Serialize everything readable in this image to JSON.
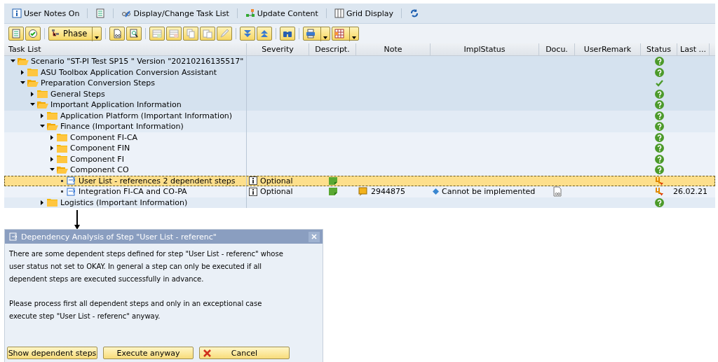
{
  "toolbar": [
    {
      "kind": "info",
      "label": "User Notes On"
    },
    {
      "kind": "list"
    },
    {
      "kind": "glasses",
      "label": "Display/Change Task List"
    },
    {
      "kind": "nodes",
      "label": "Update Content"
    },
    {
      "kind": "grid",
      "label": "Grid Display"
    },
    {
      "kind": "refresh"
    }
  ],
  "toolbar2": [
    {
      "kind": "icon"
    },
    {
      "kind": "icon"
    },
    {
      "kind": "sep"
    },
    {
      "kind": "menu",
      "label": "Phase"
    },
    {
      "kind": "sep"
    },
    {
      "kind": "icon"
    },
    {
      "kind": "icon"
    },
    {
      "kind": "sep"
    },
    {
      "kind": "icon"
    },
    {
      "kind": "icon"
    },
    {
      "kind": "icon"
    },
    {
      "kind": "icon"
    },
    {
      "kind": "icon"
    },
    {
      "kind": "sep"
    },
    {
      "kind": "icon"
    },
    {
      "kind": "icon"
    },
    {
      "kind": "sep"
    },
    {
      "kind": "icon"
    },
    {
      "kind": "sep"
    },
    {
      "kind": "menu"
    },
    {
      "kind": "menu"
    }
  ],
  "table": {
    "columns": [
      "Task List",
      "Severity",
      "Descript.",
      "Note",
      "ImplStatus",
      "Docu.",
      "UserRemark",
      "Status",
      "Last ..."
    ],
    "rows": [
      {
        "kind": "folder",
        "label": "Scenario \"ST-PI Test SP15 \" Version \"20210216135517\"",
        "expanded": true,
        "selected": false,
        "completed": false,
        "blocked": false,
        "children": [
          {
            "kind": "folder",
            "label": "ASU Toolbox Application Conversion Assistant",
            "expanded": false,
            "selected": false,
            "completed": false,
            "blocked": false
          },
          {
            "kind": "folder",
            "label": "Preparation Conversion Steps",
            "expanded": true,
            "selected": false,
            "completed": true,
            "blocked": false,
            "children": [
              {
                "kind": "folder",
                "label": "General Steps",
                "expanded": false,
                "selected": false,
                "completed": false,
                "blocked": false
              },
              {
                "kind": "folder",
                "label": "Important Application Information",
                "expanded": true,
                "selected": false,
                "completed": false,
                "blocked": false,
                "children": [
                  {
                    "kind": "folder",
                    "label": "Application Platform (Important Information)",
                    "expanded": false,
                    "selected": false,
                    "completed": false,
                    "blocked": false
                  },
                  {
                    "kind": "folder",
                    "label": "Finance (Important Information)",
                    "expanded": true,
                    "selected": false,
                    "completed": false,
                    "blocked": false,
                    "children": [
                      {
                        "kind": "folder",
                        "label": "Component FI-CA",
                        "expanded": false,
                        "selected": false,
                        "completed": false,
                        "blocked": false
                      },
                      {
                        "kind": "folder",
                        "label": "Component FIN",
                        "expanded": false,
                        "selected": false,
                        "completed": false,
                        "blocked": false
                      },
                      {
                        "kind": "folder",
                        "label": "Component FI",
                        "expanded": false,
                        "selected": false,
                        "completed": false,
                        "blocked": false
                      },
                      {
                        "kind": "folder",
                        "label": "Component CO",
                        "expanded": true,
                        "selected": false,
                        "completed": false,
                        "blocked": false,
                        "children": [
                          {
                            "kind": "step",
                            "label": "User List - references 2 dependent steps",
                            "selected": true,
                            "severity": "Optional",
                            "blocked": true
                          },
                          {
                            "kind": "step",
                            "label": "Integration FI-CA and CO-PA",
                            "selected": false,
                            "severity": "Optional",
                            "note": "2944875",
                            "impl_status": "Cannot be implemented",
                            "docu": true,
                            "blocked": true,
                            "last": "26.02.21"
                          }
                        ]
                      }
                    ]
                  },
                  {
                    "kind": "folder",
                    "label": "Logistics (Important Information)",
                    "expanded": false,
                    "selected": false,
                    "completed": false,
                    "blocked": false
                  }
                ]
              }
            ]
          }
        ]
      }
    ]
  },
  "dialog": {
    "title": "Dependency Analysis of Step \"User List - referenc\"",
    "paragraphs": [
      "There are some dependent steps defined for step \"User List - referenc\" whose user status not set to OKAY. In general a step can only be executed if all dependent steps are executed successfully in advance.",
      "Please process first all dependent steps and only in an exceptional case execute step \"User List - referenc\" anyway."
    ],
    "buttons": [
      {
        "kind": "plain",
        "label": "Show dependent steps"
      },
      {
        "kind": "plain",
        "label": "Execute anyway"
      },
      {
        "kind": "cancel",
        "label": "Cancel"
      }
    ]
  }
}
